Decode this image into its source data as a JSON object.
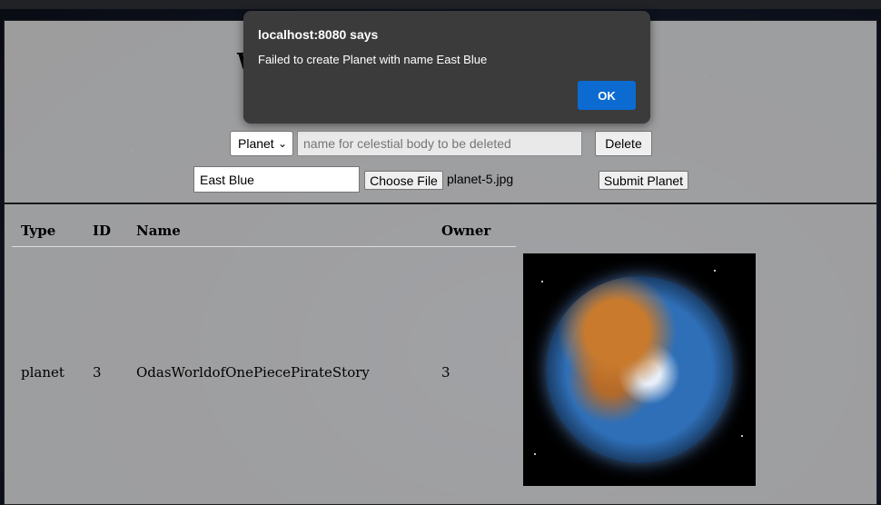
{
  "dialog": {
    "title": "localhost:8080 says",
    "message": "Failed to create Planet with name East Blue",
    "ok_label": "OK"
  },
  "header": {
    "title_fragment": "W"
  },
  "delete_form": {
    "type_value": "Planet",
    "name_placeholder": "name for celestial body to be deleted",
    "delete_label": "Delete"
  },
  "create_form": {
    "name_value": "East Blue",
    "choose_file_label": "Choose File",
    "file_name": "planet-5.jpg",
    "submit_label": "Submit Planet"
  },
  "table": {
    "columns": [
      "Type",
      "ID",
      "Name",
      "Owner"
    ],
    "rows": [
      {
        "type": "planet",
        "id": "3",
        "name": "OdasWorldofOnePiecePirateStory",
        "owner": "3"
      }
    ]
  },
  "colors": {
    "ok_button": "#0b6bd1",
    "dialog_bg": "#3b3b3b",
    "panel_bg": "#b2b2b2"
  },
  "icons": {
    "select_chevron": "chevron-down-icon",
    "planet_image": "planet-image"
  }
}
